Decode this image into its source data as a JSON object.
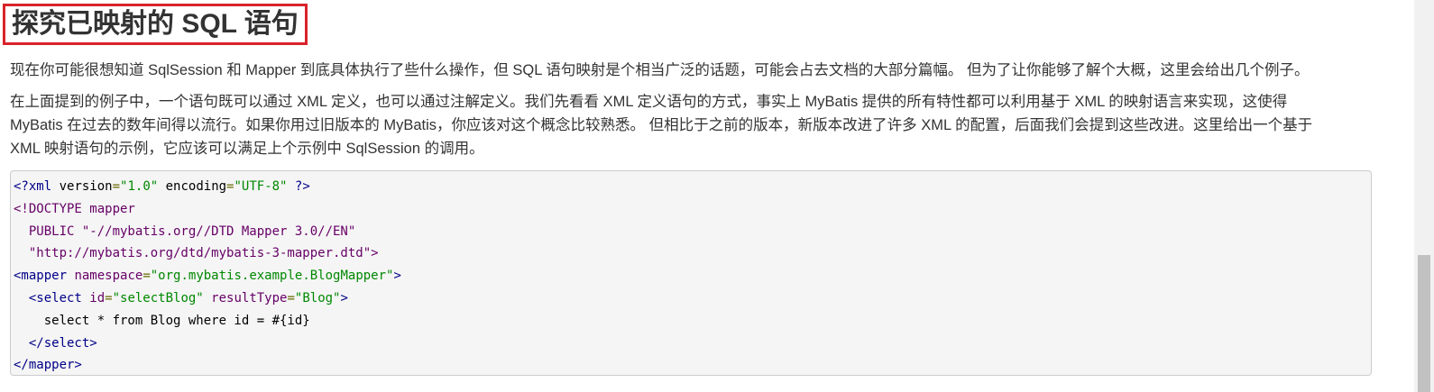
{
  "heading": {
    "title": "探究已映射的 SQL 语句"
  },
  "paragraphs": {
    "p1": "现在你可能很想知道 SqlSession 和 Mapper 到底具体执行了些什么操作，但 SQL 语句映射是个相当广泛的话题，可能会占去文档的大部分篇幅。 但为了让你能够了解个大概，这里会给出几个例子。",
    "p2_line1": "在上面提到的例子中，一个语句既可以通过 XML 定义，也可以通过注解定义。我们先看看 XML 定义语句的方式，事实上 MyBatis 提供的所有特性都可以利用基于 XML 的映射语言来实现，这使得",
    "p2_line2": "MyBatis 在过去的数年间得以流行。如果你用过旧版本的 MyBatis，你应该对这个概念比较熟悉。 但相比于之前的版本，新版本改进了许多 XML 的配置，后面我们会提到这些改进。这里给出一个基于",
    "p2_line3": "XML 映射语句的示例，它应该可以满足上个示例中 SqlSession 的调用。"
  },
  "code": {
    "l1": {
      "a": "<?xml",
      "b": " version",
      "c": "=",
      "d": "\"1.0\"",
      "e": " encoding",
      "f": "=",
      "g": "\"UTF-8\"",
      "h": " ?>"
    },
    "l2": {
      "a": "<!DOCTYPE mapper"
    },
    "l3": {
      "a": "  PUBLIC \"-//mybatis.org//DTD Mapper 3.0//EN\""
    },
    "l4": {
      "a": "  \"http://mybatis.org/dtd/mybatis-3-mapper.dtd\">"
    },
    "l5": {
      "a": "<mapper",
      "b": " namespace",
      "c": "=",
      "d": "\"org.mybatis.example.BlogMapper\"",
      "e": ">"
    },
    "l6": {
      "a": "  <select",
      "b": " id",
      "c": "=",
      "d": "\"selectBlog\"",
      "e": " resultType",
      "f": "=",
      "g": "\"Blog\"",
      "h": ">"
    },
    "l7": {
      "a": "    select * from Blog where id = #{id}"
    },
    "l8": {
      "a": "  </select>"
    },
    "l9": {
      "a": "</mapper>"
    }
  }
}
